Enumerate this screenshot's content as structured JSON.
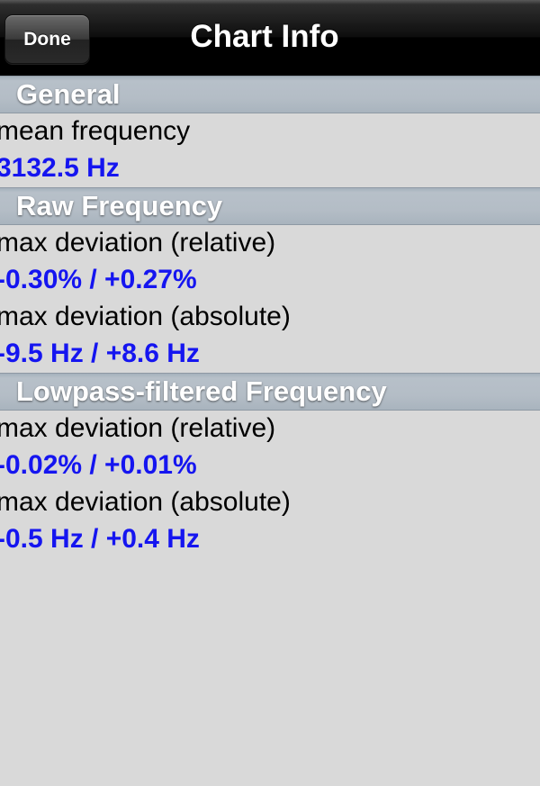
{
  "navbar": {
    "done_label": "Done",
    "title": "Chart Info"
  },
  "colors": {
    "value_text": "#1515f0",
    "section_header_bg": "#b4bdc6",
    "background": "#d9d9d9"
  },
  "sections": [
    {
      "header": "General",
      "rows": [
        {
          "label": "mean frequency",
          "value": "3132.5 Hz"
        }
      ]
    },
    {
      "header": "Raw Frequency",
      "rows": [
        {
          "label": "max deviation (relative)",
          "value": "-0.30% / +0.27%"
        },
        {
          "label": "max deviation (absolute)",
          "value": "-9.5 Hz / +8.6 Hz"
        }
      ]
    },
    {
      "header": "Lowpass-filtered Frequency",
      "rows": [
        {
          "label": "max deviation (relative)",
          "value": "-0.02% / +0.01%"
        },
        {
          "label": "max deviation (absolute)",
          "value": "-0.5 Hz / +0.4 Hz"
        }
      ]
    }
  ]
}
